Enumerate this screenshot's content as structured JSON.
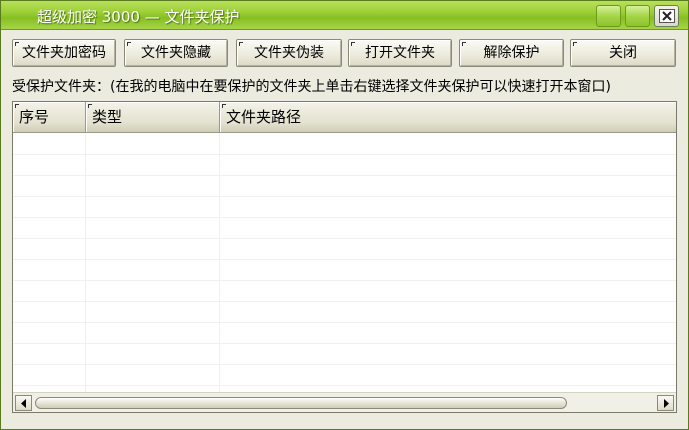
{
  "window": {
    "title": "超级加密 3000 — 文件夹保护"
  },
  "toolbar": {
    "encrypt_label": "文件夹加密码",
    "hide_label": "文件夹隐藏",
    "disguise_label": "文件夹伪装",
    "open_label": "打开文件夹",
    "remove_label": "解除保护",
    "close_label": "关闭"
  },
  "hint": {
    "text": "受保护文件夹：(在我的电脑中在要保护的文件夹上单击右键选择文件夹保护可以快速打开本窗口)"
  },
  "list": {
    "columns": [
      "序号",
      "类型",
      "文件夹路径"
    ],
    "rows": []
  },
  "icons": {
    "minimize": "minimize-icon",
    "maximize": "maximize-icon",
    "close": "close-icon",
    "scroll_left": "arrow-left-icon",
    "scroll_right": "arrow-right-icon"
  },
  "colors": {
    "titlebar": "#9ccf36",
    "window_bg": "#ecebdf",
    "title_text": "#ffffff"
  }
}
